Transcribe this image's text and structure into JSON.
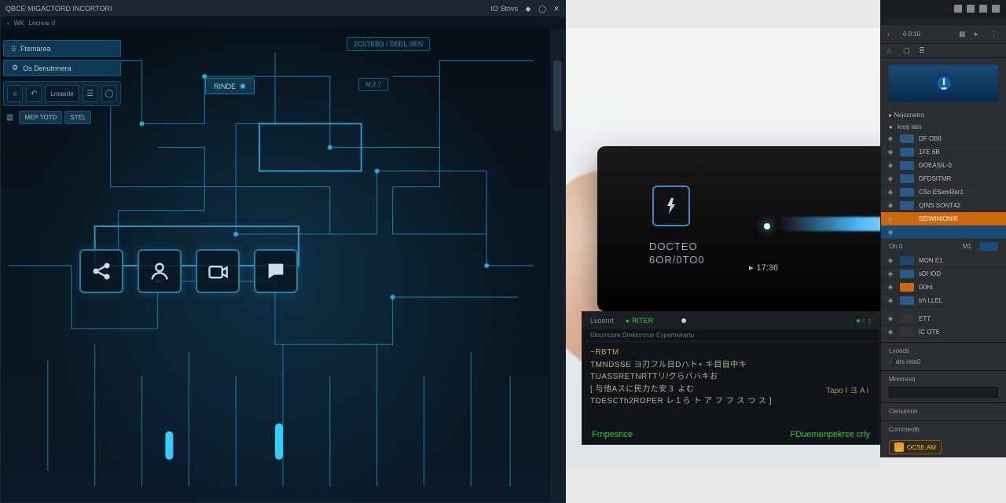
{
  "left_window": {
    "title": "QBCE MIGACTORD INCORTORI",
    "status": "IO Stnvs",
    "sub": {
      "arrow": "‹",
      "label": "WK",
      "crumb": "Lecrear II"
    },
    "sidebar": {
      "pills": [
        {
          "icon": "bookmark",
          "label": "Ftemarea"
        },
        {
          "icon": "gear",
          "label": "Os Denutrmera"
        }
      ],
      "tool": {
        "search_icon": "⌕",
        "undo_icon": "↶",
        "field": "Lnoarde",
        "menu_icon": "≡",
        "user_icon": "◯"
      },
      "chips": [
        "MEP TOTD",
        "STEL"
      ]
    },
    "floaters": {
      "chip1": "RINDE",
      "top_label": "2C07EB3 / D5EL 9EN",
      "small": "M.2.7"
    },
    "dock": [
      {
        "name": "share",
        "title": "Share"
      },
      {
        "name": "user",
        "title": "User"
      },
      {
        "name": "camera",
        "title": "Camera"
      },
      {
        "name": "chat",
        "title": "Chat"
      }
    ]
  },
  "device": {
    "line1": "DOCTEO",
    "line2": "6OR/0TO0",
    "time": "17:36"
  },
  "terminal": {
    "tabs": [
      "Lvoenrt",
      "RITER"
    ],
    "subtitle": "Etnumcore Drekicrcrun Cypemnirartu",
    "lines": [
      "~RBTM",
      "TMNDSSE ヨ刃フル日Dハト+  キ目自中キ",
      "TUASSRETNRTTリ/クらバハキお",
      "[ 与他Aスに民力た安３ よむ",
      "TDESCTh2ROPER レ１ら ト   ア  フ フ ス つ ス ]"
    ],
    "right_text": "Tapo I ヨ A i",
    "foot_left": "Frnpesnce",
    "foot_right": "FDuemenpekrce crly",
    "indicators": "●○ ↕"
  },
  "props": {
    "toolbar_num": "0 0:10",
    "section1": "Nejosnetro",
    "sub1": "krep lato",
    "layers": [
      {
        "name": "DF OB6",
        "sw": "#2a5a8a"
      },
      {
        "name": "1FE 6B",
        "sw": "#2a5a8a"
      },
      {
        "name": "DOEASIL-0",
        "sw": "#2a5a8a"
      },
      {
        "name": "DFDSITMR",
        "sw": "#2a5a8a"
      },
      {
        "name": "CSn ESemRer1",
        "sw": "#2a5a8a"
      },
      {
        "name": "QINS SONT42",
        "sw": "#2a5a8a"
      },
      {
        "name": "SEIWINIONI6",
        "sw": "#d0680a",
        "sel": true
      },
      {
        "name": "",
        "sw": "#1a4a7a",
        "blue": true
      }
    ],
    "mixrow": {
      "a": "On 0",
      "b": "M1"
    },
    "layers2": [
      {
        "name": "MON E1",
        "sw": "#1e4870"
      },
      {
        "name": "sDI  lOD",
        "sw": "#2a5a8a"
      },
      {
        "name": "D0Hi",
        "sw": "#d0680a"
      },
      {
        "name": "trh  LLEL",
        "sw": "#2a5a8a"
      }
    ],
    "layers3": [
      {
        "name": "ETT",
        "sw": "#333"
      },
      {
        "name": "IC OT6",
        "sw": "#333"
      }
    ],
    "sec2": "Lvoeds",
    "sec2_val": "drs reto0",
    "sec3": "Mrecnretr",
    "sec4": "Cenvennn",
    "sec5": "Commeolb",
    "badge": "OCSE.AM"
  }
}
